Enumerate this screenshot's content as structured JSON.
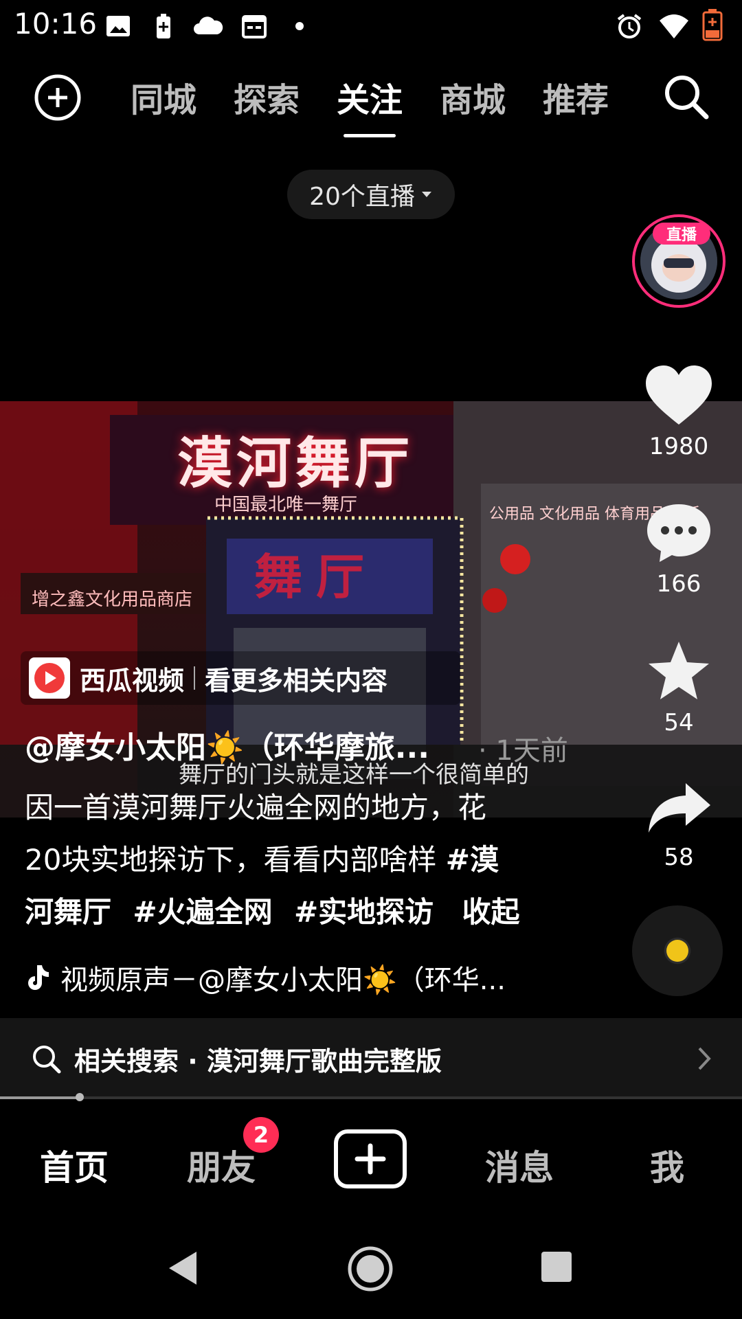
{
  "status_bar": {
    "time": "10:16",
    "icons": [
      "image-icon",
      "battery-saver-icon",
      "cloud-icon",
      "calendar-icon",
      "dot-icon",
      "alarm-icon",
      "wifi-icon",
      "battery-icon"
    ]
  },
  "top_nav": {
    "tabs": [
      {
        "label": "同城",
        "active": false
      },
      {
        "label": "探索",
        "active": false
      },
      {
        "label": "关注",
        "active": true
      },
      {
        "label": "商城",
        "active": false
      },
      {
        "label": "推荐",
        "active": false
      }
    ]
  },
  "live_pill": {
    "label": "20个直播"
  },
  "right_rail": {
    "live_badge": "直播",
    "likes": "1980",
    "comments": "166",
    "favorites": "54",
    "shares": "58"
  },
  "video": {
    "sign_main": "漠河舞厅",
    "sign_sub": "中国最北唯一舞厅",
    "door_sign": "舞厅",
    "shop_left": "增之鑫文化用品商店",
    "shop_right": "公用品 文化用品 体育用品 电话"
  },
  "source_chip": {
    "app": "西瓜视频",
    "action": "看更多相关内容"
  },
  "post": {
    "author": "@摩女小太阳☀️（环华摩旅...",
    "time_ago": "· 1天前",
    "subtitle": "舞厅的门头就是这样一个很简单的",
    "desc_line1": "因一首漠河舞厅火遍全网的地方，花",
    "desc_line2": "20块实地探访下，看看内部啥样 ",
    "tag1": "#漠",
    "tag1b": "河舞厅",
    "tag2": "#火遍全网",
    "tag3": "#实地探访",
    "collapse": "收起"
  },
  "music": {
    "text": "视频原声－@摩女小太阳☀️（环华..."
  },
  "related_search": {
    "text": "相关搜索 · 漠河舞厅歌曲完整版"
  },
  "progress": {
    "value": 0.107
  },
  "tabbar": {
    "tabs": [
      {
        "label": "首页",
        "active": true
      },
      {
        "label": "朋友",
        "active": false,
        "badge": "2"
      },
      {
        "label": "消息",
        "active": false
      },
      {
        "label": "我",
        "active": false
      }
    ]
  },
  "colors": {
    "accent": "#ff2d7a",
    "badge": "#ff2d55",
    "bg": "#000000"
  }
}
